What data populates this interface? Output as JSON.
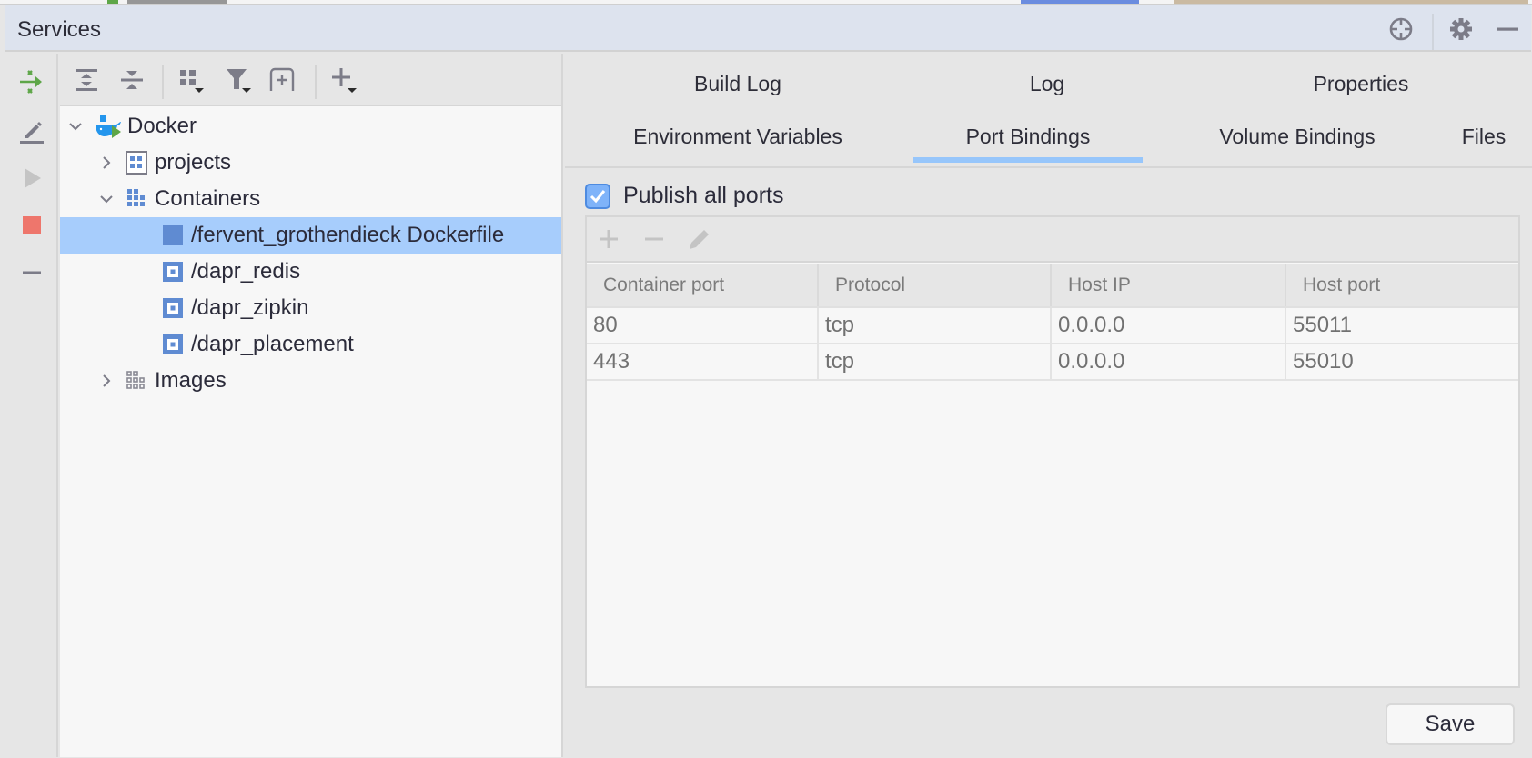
{
  "header": {
    "title": "Services",
    "icons": [
      "crosshair-icon",
      "gear-icon",
      "minimize-icon"
    ]
  },
  "left_strip": {
    "icons": [
      "open-in-split-icon",
      "edit-icon",
      "run-icon",
      "stop-icon",
      "remove-icon"
    ]
  },
  "tree_toolbar": {
    "icons": [
      "expand-all-icon",
      "collapse-all-icon",
      "group-by-icon",
      "filter-icon",
      "new-tab-icon",
      "add-service-icon"
    ]
  },
  "tree": {
    "items": [
      {
        "label": "Docker",
        "level": 0,
        "expanded": true,
        "icon": "docker-icon"
      },
      {
        "label": "projects",
        "level": 1,
        "expanded": false,
        "icon": "projects-icon"
      },
      {
        "label": "Containers",
        "level": 1,
        "expanded": true,
        "icon": "containers-icon"
      },
      {
        "label": "/fervent_grothendieck Dockerfile",
        "level": 2,
        "selected": true,
        "icon": "container-running-icon"
      },
      {
        "label": "/dapr_redis",
        "level": 2,
        "icon": "container-icon"
      },
      {
        "label": "/dapr_zipkin",
        "level": 2,
        "icon": "container-icon"
      },
      {
        "label": "/dapr_placement",
        "level": 2,
        "icon": "container-icon"
      },
      {
        "label": "Images",
        "level": 1,
        "expanded": false,
        "icon": "images-icon"
      }
    ]
  },
  "tabs": {
    "row1": [
      "Build Log",
      "Log",
      "Properties"
    ],
    "row2": [
      "Environment Variables",
      "Port Bindings",
      "Volume Bindings",
      "Files"
    ],
    "active": "Port Bindings"
  },
  "port_bindings": {
    "publish_all_label": "Publish all ports",
    "publish_all_checked": true,
    "toolbar": [
      "add-icon",
      "remove-icon",
      "edit-icon"
    ],
    "columns": [
      "Container port",
      "Protocol",
      "Host IP",
      "Host port"
    ],
    "rows": [
      [
        "80",
        "tcp",
        "0.0.0.0",
        "55011"
      ],
      [
        "443",
        "tcp",
        "0.0.0.0",
        "55010"
      ]
    ]
  },
  "save_label": "Save",
  "colors": {
    "header_bg": "#dde3ee",
    "selection": "#a7cdfc",
    "tab_underline": "#97c6fb",
    "stop": "#ee766c",
    "run_green": "#5ea648",
    "container_blue": "#5f8bd2"
  }
}
